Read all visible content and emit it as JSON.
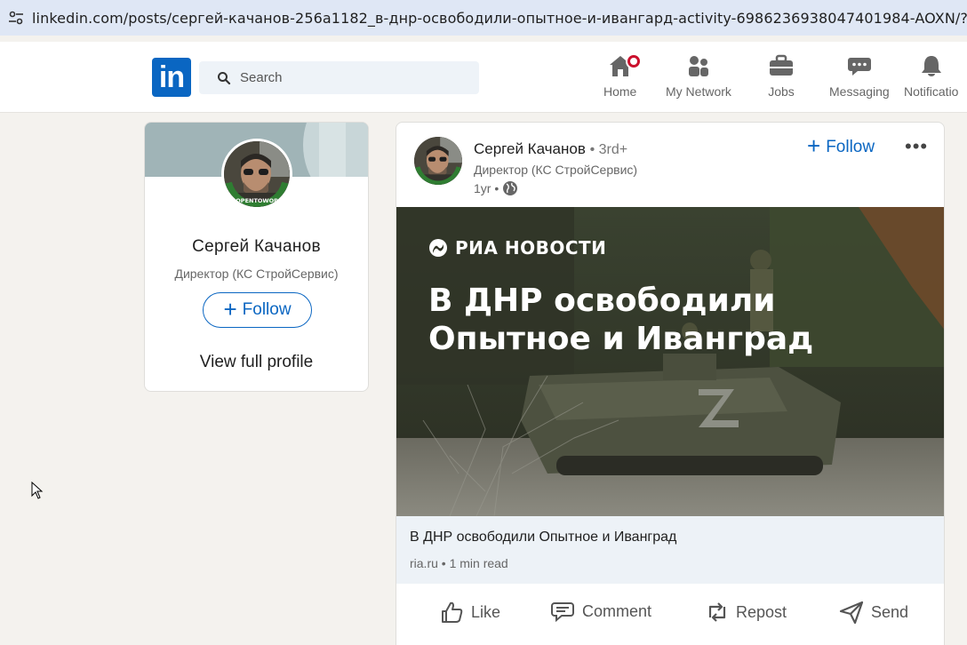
{
  "browser": {
    "url": "linkedin.com/posts/сергей-качанов-256a1182_в-днр-освободили-опытное-и-ивангард-activity-6986236938047401984-AOXN/?utm_"
  },
  "header": {
    "logo": "in",
    "search_placeholder": "Search",
    "nav": [
      {
        "label": "Home",
        "icon": "home-icon"
      },
      {
        "label": "My Network",
        "icon": "network-icon"
      },
      {
        "label": "Jobs",
        "icon": "briefcase-icon"
      },
      {
        "label": "Messaging",
        "icon": "messaging-icon"
      },
      {
        "label": "Notificatio",
        "icon": "bell-icon"
      }
    ]
  },
  "profile_card": {
    "name": "Сергей Качанов",
    "title": "Директор (КС СтройСервис)",
    "follow_label": "Follow",
    "view_profile": "View full profile",
    "avatar_frame_text": "#OPENTOWORK"
  },
  "post": {
    "author": "Сергей Качанов",
    "degree": "• 3rd+",
    "headline": "Директор (КС СтройСервис)",
    "time": "1yr •",
    "follow_label": "Follow",
    "more": "•••",
    "image": {
      "brand": "РИА НОВОСТИ",
      "headline": "В ДНР освободили Опытное и Иванград"
    },
    "link": {
      "title": "В ДНР освободили Опытное и Иванград",
      "source": "ria.ru • 1 min read"
    },
    "actions": {
      "like": "Like",
      "comment": "Comment",
      "repost": "Repost",
      "send": "Send"
    }
  },
  "colors": {
    "brand": "#0a66c2",
    "notification_badge": "#cb112d",
    "opentowork_green": "#2f7d32"
  }
}
